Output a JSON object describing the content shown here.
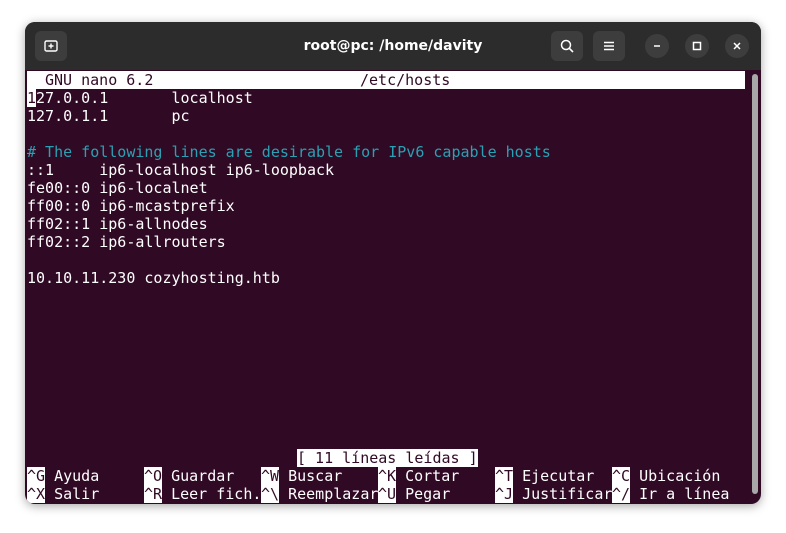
{
  "window": {
    "title": "root@pc: /home/davity",
    "colors": {
      "terminal_bg": "#300a24",
      "titlebar_bg": "#2c2c2c",
      "comment": "#2aa1b3"
    }
  },
  "nano": {
    "version": "GNU nano 6.2",
    "filename": "/etc/hosts",
    "lines": [
      {
        "text": "127.0.0.1       localhost",
        "type": "normal"
      },
      {
        "text": "127.0.1.1       pc",
        "type": "normal"
      },
      {
        "text": "",
        "type": "normal"
      },
      {
        "text": "# The following lines are desirable for IPv6 capable hosts",
        "type": "comment"
      },
      {
        "text": "::1     ip6-localhost ip6-loopback",
        "type": "normal"
      },
      {
        "text": "fe00::0 ip6-localnet",
        "type": "normal"
      },
      {
        "text": "ff00::0 ip6-mcastprefix",
        "type": "normal"
      },
      {
        "text": "ff02::1 ip6-allnodes",
        "type": "normal"
      },
      {
        "text": "ff02::2 ip6-allrouters",
        "type": "normal"
      },
      {
        "text": "",
        "type": "normal"
      },
      {
        "text": "10.10.11.230 cozyhosting.htb",
        "type": "normal"
      }
    ],
    "status": "[ 11 líneas leídas ]",
    "shortcuts_row1": [
      {
        "key": "^G",
        "label": "Ayuda"
      },
      {
        "key": "^O",
        "label": "Guardar"
      },
      {
        "key": "^W",
        "label": "Buscar"
      },
      {
        "key": "^K",
        "label": "Cortar"
      },
      {
        "key": "^T",
        "label": "Ejecutar"
      },
      {
        "key": "^C",
        "label": "Ubicación"
      }
    ],
    "shortcuts_row2": [
      {
        "key": "^X",
        "label": "Salir"
      },
      {
        "key": "^R",
        "label": "Leer fich."
      },
      {
        "key": "^\\",
        "label": "Reemplazar"
      },
      {
        "key": "^U",
        "label": "Pegar"
      },
      {
        "key": "^J",
        "label": "Justificar"
      },
      {
        "key": "^/",
        "label": "Ir a línea"
      }
    ]
  }
}
